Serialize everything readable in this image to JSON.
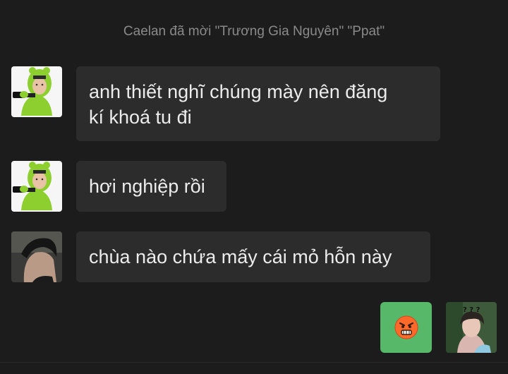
{
  "system_message": "Caelan đã mời \"Trương Gia Nguyên\" \"Ppat\"",
  "messages": [
    {
      "sender": "other",
      "avatar_icon": "frog-costume-avatar",
      "lines": [
        "anh thiết nghĩ chúng mày nên đăng",
        "kí khoá tu đi"
      ]
    },
    {
      "sender": "other",
      "avatar_icon": "frog-costume-avatar",
      "lines": [
        "hơi nghiệp rồi"
      ]
    },
    {
      "sender": "other",
      "avatar_icon": "boy-profile-avatar",
      "lines": [
        "chùa nào chứa mấy cái mỏ hỗn này"
      ]
    },
    {
      "sender": "self",
      "avatar_icon": "boy-question-marks-avatar",
      "sticker": "angry-face-emoji",
      "bubble_color": "#57b86a"
    }
  ],
  "avatar_question_text": "? ? ?"
}
